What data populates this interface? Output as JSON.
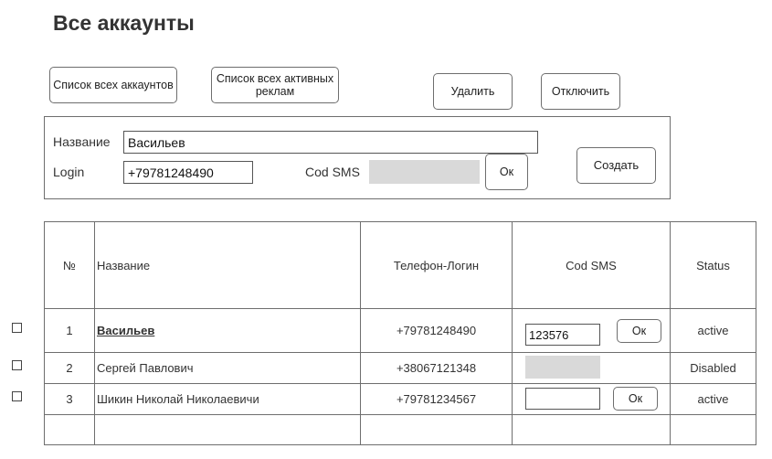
{
  "page": {
    "title": "Все аккаунты"
  },
  "toolbar": {
    "all_accounts": "Список всех аккаунтов",
    "all_active_ads": "Список всех активных реклам",
    "delete": "Удалить",
    "disable": "Отключить"
  },
  "form": {
    "name_label": "Название",
    "name_value": "Васильев",
    "login_label": "Login",
    "login_value": "+79781248490",
    "sms_label": "Cod SMS",
    "sms_value": "",
    "ok_label": "Ок",
    "create_label": "Создать"
  },
  "table": {
    "headers": {
      "num": "№",
      "name": "Название",
      "phone": "Телефон-Логин",
      "sms": "Cod SMS",
      "status": "Status"
    },
    "rows": [
      {
        "num": "1",
        "name": "Васильев",
        "phone": "+79781248490",
        "sms": "123576",
        "ok": "Ок",
        "status": "active"
      },
      {
        "num": "2",
        "name": "Сергей Павлович",
        "phone": "+38067121348",
        "sms": "",
        "status": "Disabled"
      },
      {
        "num": "3",
        "name": "Шикин Николай Николаевичи",
        "phone": "+79781234567",
        "sms": "",
        "ok": "Ок",
        "status": "active"
      }
    ]
  }
}
